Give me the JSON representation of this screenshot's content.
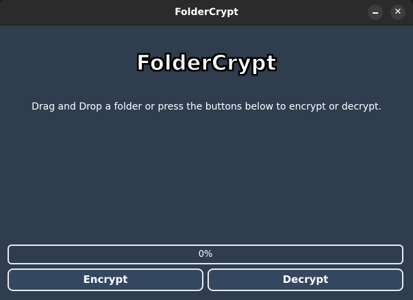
{
  "window": {
    "title": "FolderCrypt"
  },
  "app": {
    "heading": "FolderCrypt",
    "instructions": "Drag and Drop a folder or press the buttons below to encrypt or decrypt."
  },
  "progress": {
    "value": 0,
    "label": "0%"
  },
  "actions": {
    "encrypt_label": "Encrypt",
    "decrypt_label": "Decrypt"
  },
  "icons": {
    "minimize": "minimize-icon",
    "close": "close-icon"
  },
  "colors": {
    "background": "#2f3d4f",
    "titlebar": "#2b2b2b",
    "button_bg": "#334760",
    "border": "#e9ecef",
    "text": "#ffffff"
  }
}
